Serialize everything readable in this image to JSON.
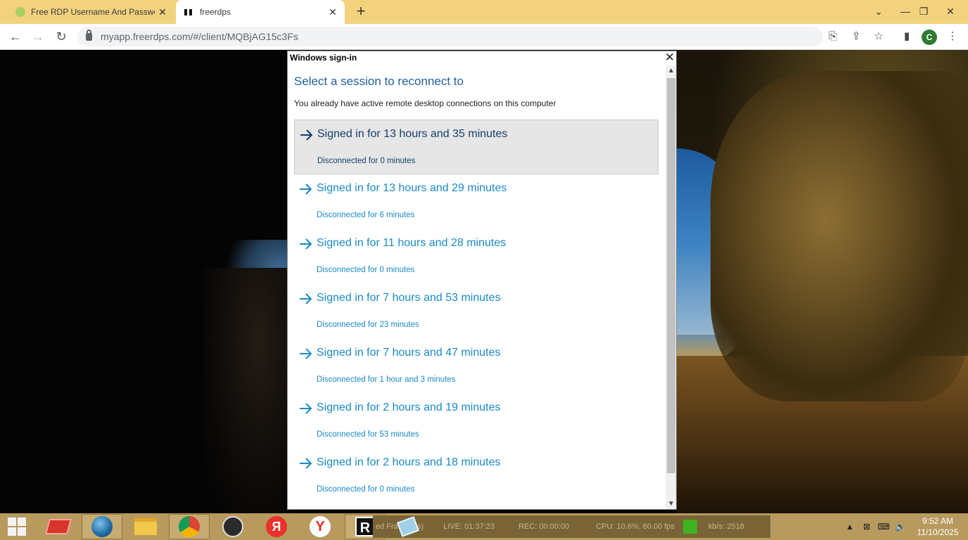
{
  "browser": {
    "tabs": [
      {
        "title": "Free RDP Username And Passwo",
        "active": false
      },
      {
        "title": "freerdps",
        "active": true
      }
    ],
    "url": "myapp.freerdps.com/#/client/MQBjAG15c3Fs",
    "profile_initial": "C"
  },
  "dialog": {
    "title": "Windows sign-in",
    "heading": "Select a session to reconnect to",
    "subtitle": "You already have active remote desktop connections on this computer",
    "sessions": [
      {
        "signed": "Signed in for 13 hours and 35 minutes",
        "disconnected": "Disconnected for 0 minutes",
        "selected": true
      },
      {
        "signed": "Signed in for 13 hours and 29 minutes",
        "disconnected": "Disconnected for 6 minutes"
      },
      {
        "signed": "Signed in for 11 hours and 28 minutes",
        "disconnected": "Disconnected for 0 minutes"
      },
      {
        "signed": "Signed in for 7 hours and 53 minutes",
        "disconnected": "Disconnected for 23 minutes"
      },
      {
        "signed": "Signed in for 7 hours and 47 minutes",
        "disconnected": "Disconnected for 1 hour and 3 minutes"
      },
      {
        "signed": "Signed in for 2 hours and 19 minutes",
        "disconnected": "Disconnected for 53 minutes"
      },
      {
        "signed": "Signed in for 2 hours and 18 minutes",
        "disconnected": "Disconnected for 0 minutes"
      }
    ]
  },
  "taskbar": {
    "obs": {
      "dropped": "ed Fra",
      "dropped_pct": "(0.0%)",
      "live": "LIVE: 01:37:23",
      "rec": "REC: 00:00:00",
      "cpu": "CPU: 10.6%, 60.00 fps",
      "kbs": "kb/s: 2518"
    },
    "clock_time": "9:52 AM",
    "clock_date": "11/10/2025"
  }
}
